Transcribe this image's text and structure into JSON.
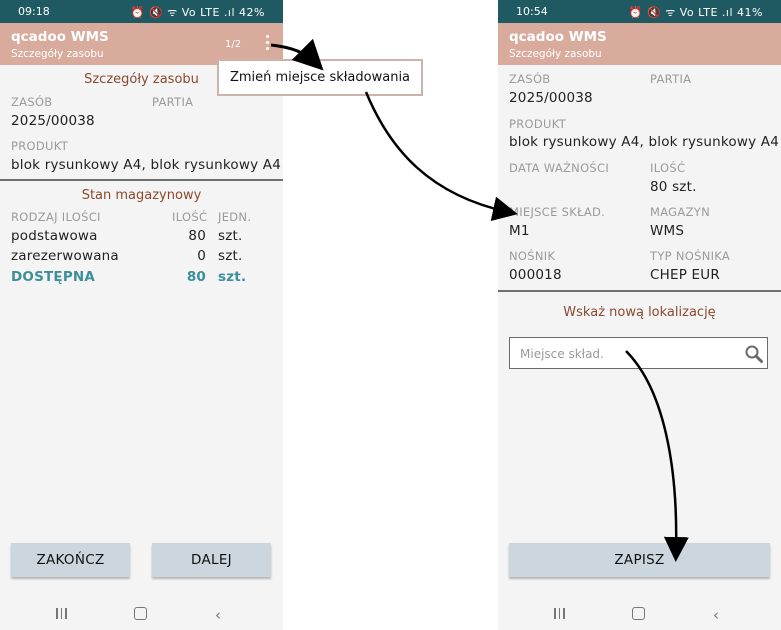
{
  "status_left": {
    "time": "09:18",
    "icons": "⏰ 🔇 ᯤ Vo LTE .ıl 42%"
  },
  "status_right": {
    "time": "10:54",
    "icons": "⏰ 🔇 ᯤ Vo LTE .ıl 41%"
  },
  "appbar": {
    "title": "qcadoo WMS",
    "subtitle": "Szczegóły zasobu",
    "pager": "1/2"
  },
  "left": {
    "section_details": "Szczegóły zasobu",
    "labels": {
      "resource": "ZASÓB",
      "batch": "PARTIA",
      "product": "PRODUKT"
    },
    "values": {
      "resource": "2025/00038",
      "product": "blok rysunkowy A4, blok rysunkowy A4"
    },
    "section_stock": "Stan magazynowy",
    "table": {
      "headers": [
        "RODZAJ ILOŚCI",
        "ILOŚĆ",
        "JEDN."
      ],
      "rows": [
        {
          "type": "podstawowa",
          "qty": "80",
          "unit": "szt."
        },
        {
          "type": "zarezerwowana",
          "qty": "0",
          "unit": "szt."
        },
        {
          "type": "DOSTĘPNA",
          "qty": "80",
          "unit": "szt."
        }
      ]
    },
    "buttons": {
      "finish": "ZAKOŃCZ",
      "next": "DALEJ"
    }
  },
  "callout": "Zmień miejsce składowania",
  "right": {
    "labels": {
      "resource": "ZASÓB",
      "batch": "PARTIA",
      "product": "PRODUKT",
      "expiry": "DATA WAŻNOŚCI",
      "quantity": "ILOŚĆ",
      "storage": "MIEJSCE SKŁAD.",
      "warehouse": "MAGAZYN",
      "carrier": "NOŚNIK",
      "carrier_type": "TYP NOŚNIKA"
    },
    "values": {
      "resource": "2025/00038",
      "product": "blok rysunkowy A4, blok rysunkowy A4",
      "quantity": "80 szt.",
      "storage": "M1",
      "warehouse": "WMS",
      "carrier": "000018",
      "carrier_type": "CHEP EUR"
    },
    "section_new_location": "Wskaż nową lokalizację",
    "search": {
      "placeholder": "Miejsce skład.",
      "value": ""
    },
    "buttons": {
      "save": "ZAPISZ"
    }
  },
  "icons": {
    "kebab": "more-vert-icon",
    "search": "search-icon",
    "nav_recent": "recent-apps-icon",
    "nav_home": "home-icon",
    "nav_back": "back-icon"
  },
  "colors": {
    "statusbar": "#1f5a63",
    "appbar": "#d8ab9c",
    "section_title": "#8b4a2e",
    "accent": "#3d8e9b",
    "button": "#cbd6de",
    "background": "#f4f4f4"
  }
}
